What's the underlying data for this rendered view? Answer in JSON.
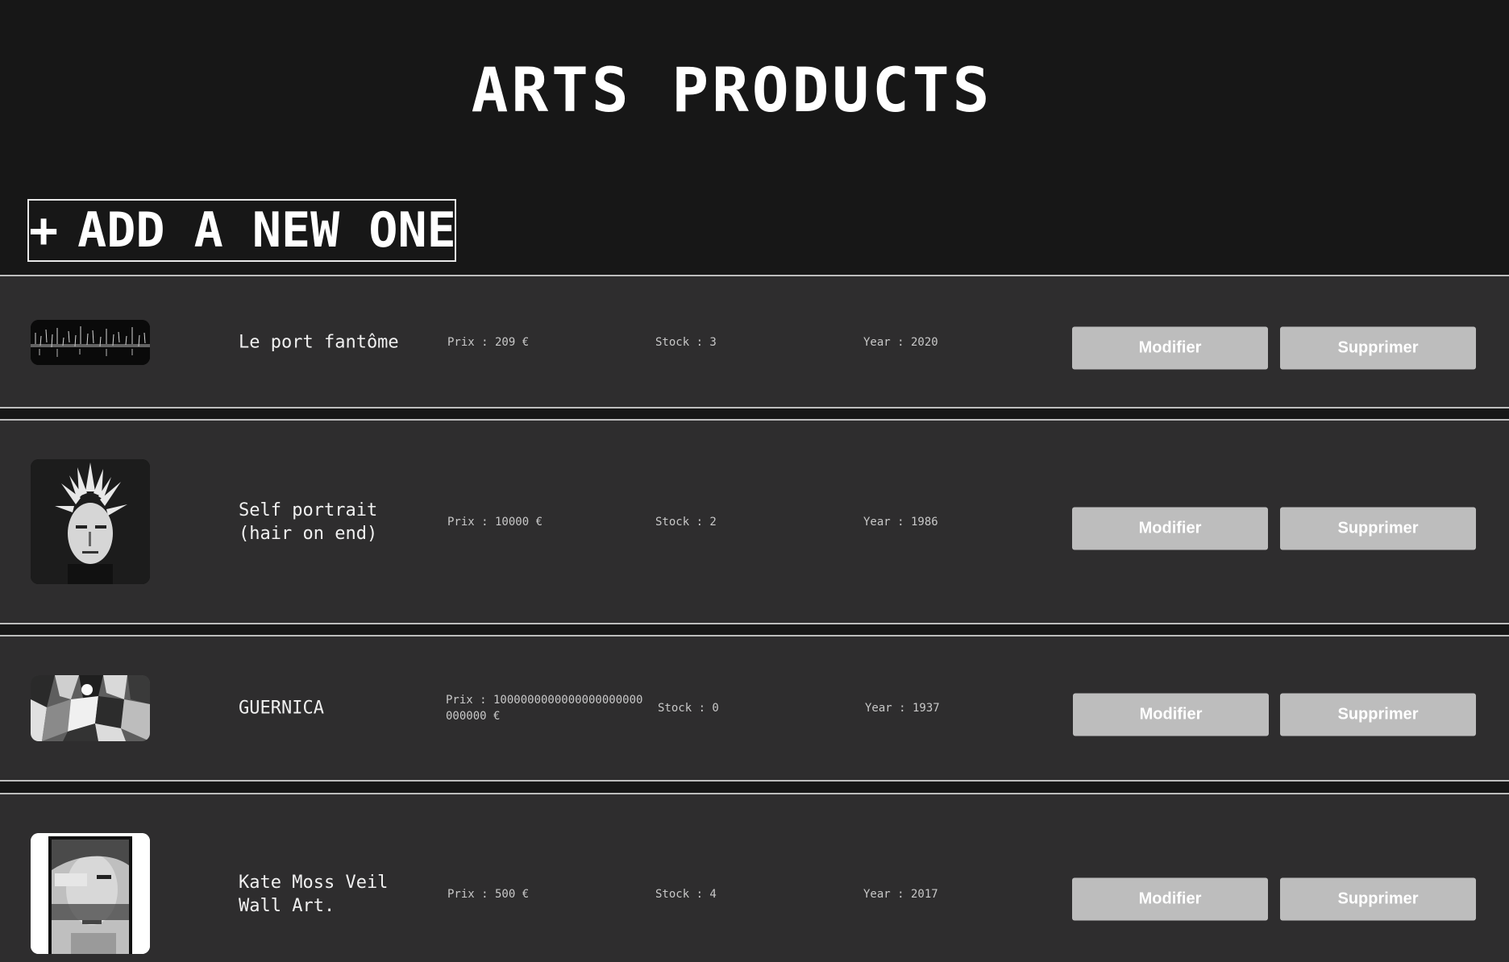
{
  "page": {
    "title": "ARTS PRODUCTS",
    "add_button_plus": "+",
    "add_button_label": "ADD A NEW ONE"
  },
  "products": [
    {
      "name": "Le port fantôme",
      "price": "Prix : 209 €",
      "stock": "Stock : 3",
      "year": "Year : 2020",
      "modify_label": "Modifier",
      "delete_label": "Supprimer"
    },
    {
      "name": "Self portrait (hair on end)",
      "price": "Prix : 10000 €",
      "stock": "Stock : 2",
      "year": "Year : 1986",
      "modify_label": "Modifier",
      "delete_label": "Supprimer"
    },
    {
      "name": "GUERNICA",
      "price": "Prix : 1000000000000000000000000000 €",
      "stock": "Stock : 0",
      "year": "Year : 1937",
      "modify_label": "Modifier",
      "delete_label": "Supprimer"
    },
    {
      "name": "Kate Moss Veil Wall Art.",
      "price": "Prix : 500 €",
      "stock": "Stock : 4",
      "year": "Year : 2017",
      "modify_label": "Modifier",
      "delete_label": "Supprimer"
    }
  ]
}
